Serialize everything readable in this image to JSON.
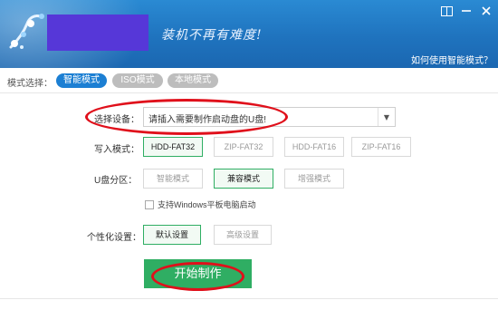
{
  "header": {
    "slogan": "装机不再有难度!",
    "help_link": "如何使用智能模式？",
    "icons": [
      "book-icon",
      "minimize-icon",
      "close-icon"
    ]
  },
  "mode_bar": {
    "label": "模式选择：",
    "tabs": [
      {
        "label": "智能模式",
        "active": true
      },
      {
        "label": "ISO模式",
        "active": false
      },
      {
        "label": "本地模式",
        "active": false
      }
    ]
  },
  "device": {
    "label": "选择设备：",
    "value": "请插入需要制作启动盘的U盘!"
  },
  "write_mode": {
    "label": "写入模式：",
    "options": [
      "HDD-FAT32",
      "ZIP-FAT32",
      "HDD-FAT16",
      "ZIP-FAT16"
    ],
    "selected": "HDD-FAT32"
  },
  "partition": {
    "label": "U盘分区：",
    "options": [
      "智能模式",
      "兼容模式",
      "增强模式"
    ],
    "selected": "兼容模式"
  },
  "tablet_support": {
    "label": "支持Windows平板电脑启动",
    "checked": false
  },
  "personalize": {
    "label": "个性化设置：",
    "options": [
      "默认设置",
      "高级设置"
    ],
    "selected": "默认设置"
  },
  "start_button": {
    "label": "开始制作"
  },
  "colors": {
    "header_blue": "#1f73be",
    "accent_blue": "#1c7fd3",
    "accent_green": "#2fae63",
    "annotation_red": "#e0101b",
    "brand_block": "#5637d8"
  }
}
